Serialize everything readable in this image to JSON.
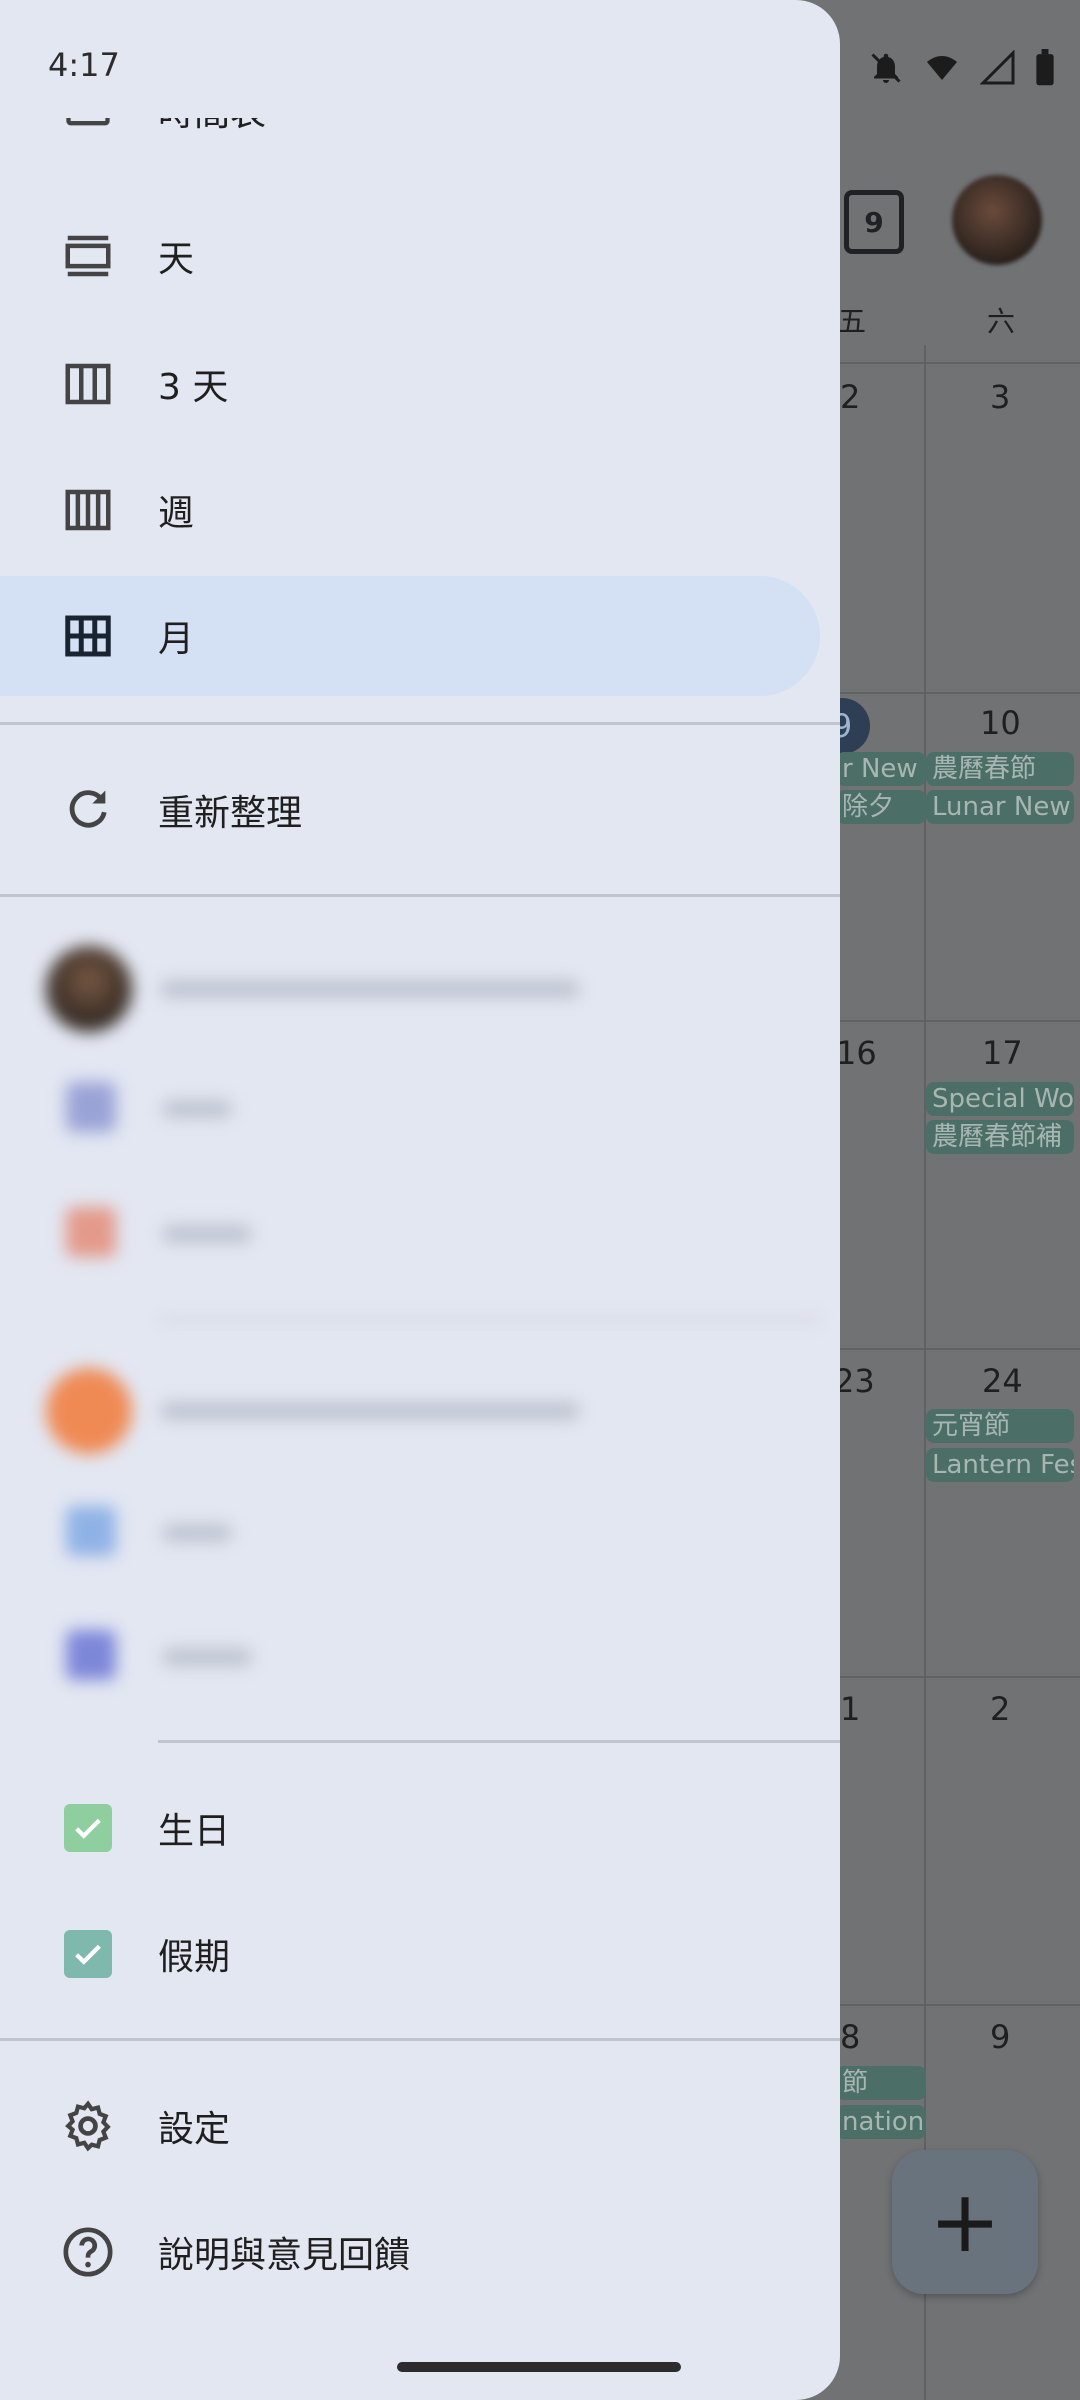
{
  "status": {
    "time": "4:17"
  },
  "drawer": {
    "views": [
      {
        "label": "時間表",
        "icon": "schedule-icon"
      },
      {
        "label": "天",
        "icon": "day-view-icon"
      },
      {
        "label": "3 天",
        "icon": "three-day-view-icon"
      },
      {
        "label": "週",
        "icon": "week-view-icon"
      },
      {
        "label": "月",
        "icon": "month-view-icon",
        "selected": true
      }
    ],
    "refresh": {
      "label": "重新整理",
      "icon": "refresh-icon"
    },
    "calendars": [
      {
        "label": "生日",
        "color": "#8fcf9f",
        "checked": true
      },
      {
        "label": "假期",
        "color": "#7fb9ad",
        "checked": true
      }
    ],
    "settings": {
      "label": "設定",
      "icon": "gear-icon"
    },
    "help": {
      "label": "說明與意見回饋",
      "icon": "help-icon"
    }
  },
  "background_calendar": {
    "today_badge": "9",
    "weekday_headers": [
      "五",
      "六"
    ],
    "dates": [
      "2",
      "3",
      "9",
      "10",
      "16",
      "17",
      "23",
      "24",
      "1",
      "2",
      "8",
      "9"
    ],
    "events": [
      "r New",
      "農曆春節",
      "除夕",
      "Lunar New",
      "Special Wo",
      "農曆春節補",
      "元宵節",
      "Lantern Fes",
      "節",
      "nation"
    ]
  },
  "colors": {
    "drawer_bg": "#e3e7f2",
    "selected_bg": "#d4e0f4",
    "event_chip": "#4b6e66",
    "scrim": "#707274"
  }
}
